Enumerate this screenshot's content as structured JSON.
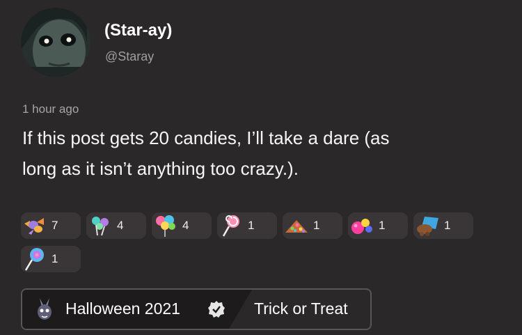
{
  "user": {
    "display_name": "(Star-ay)",
    "handle": "@Staray"
  },
  "post": {
    "timestamp": "1 hour ago",
    "line1": "If this post gets 20 candies, I’ll take a dare (as",
    "line2": "long as it isn’t anything too crazy.)."
  },
  "reactions": [
    {
      "icon": "wrapped-candy-icon",
      "count": "7"
    },
    {
      "icon": "cotton-candy-icon",
      "count": "4"
    },
    {
      "icon": "balloons-icon",
      "count": "4"
    },
    {
      "icon": "lollipop-icon",
      "count": "1"
    },
    {
      "icon": "candy-pile-icon",
      "count": "1"
    },
    {
      "icon": "gumballs-icon",
      "count": "1"
    },
    {
      "icon": "candy-bag-icon",
      "count": "1"
    },
    {
      "icon": "round-lollipop-icon",
      "count": "1"
    }
  ],
  "tag": {
    "event_name": "Halloween 2021",
    "label": "Trick or Treat"
  }
}
